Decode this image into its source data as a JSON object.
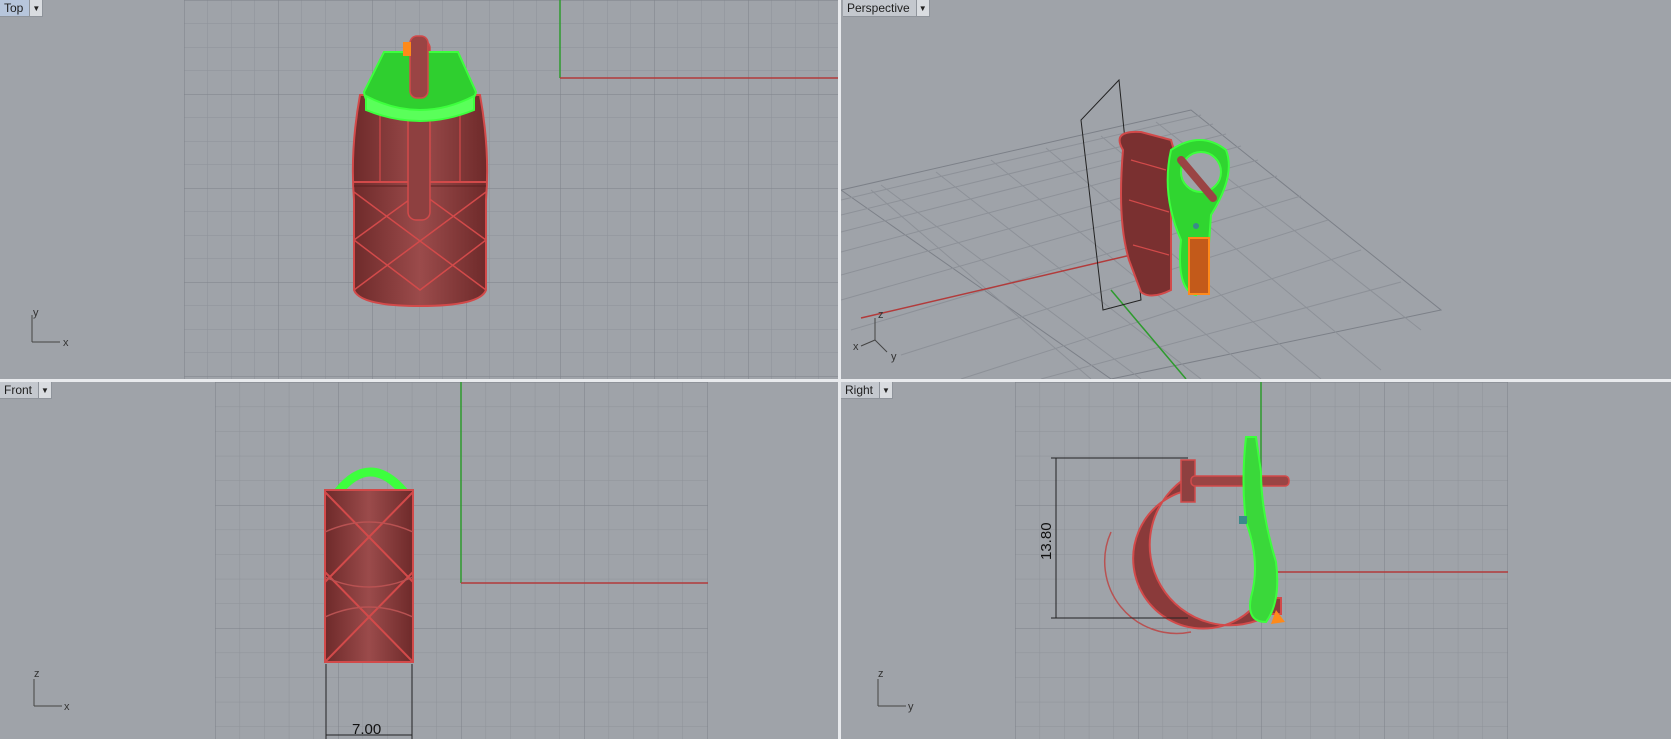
{
  "viewports": {
    "top": {
      "label": "Top",
      "axes": {
        "a": "y",
        "b": "x"
      }
    },
    "perspective": {
      "label": "Perspective",
      "axes": {
        "a": "z",
        "b": "x",
        "c": "y"
      }
    },
    "front": {
      "label": "Front",
      "axes": {
        "a": "z",
        "b": "x"
      },
      "dimension": "7.00"
    },
    "right": {
      "label": "Right",
      "axes": {
        "a": "z",
        "b": "y"
      },
      "dimension": "13.80"
    }
  },
  "colors": {
    "background": "#9fa3a9",
    "grid": "#8d9198",
    "grid_major": "#7c8088",
    "x_axis": "#b23b3b",
    "y_axis": "#2e9b2e",
    "object": "#8a3a3a",
    "object_edge": "#d24a4a",
    "selected": "#3dff3d",
    "highlight": "#ff8a1a"
  },
  "icons": {
    "dropdown": "chevron-down-icon"
  }
}
